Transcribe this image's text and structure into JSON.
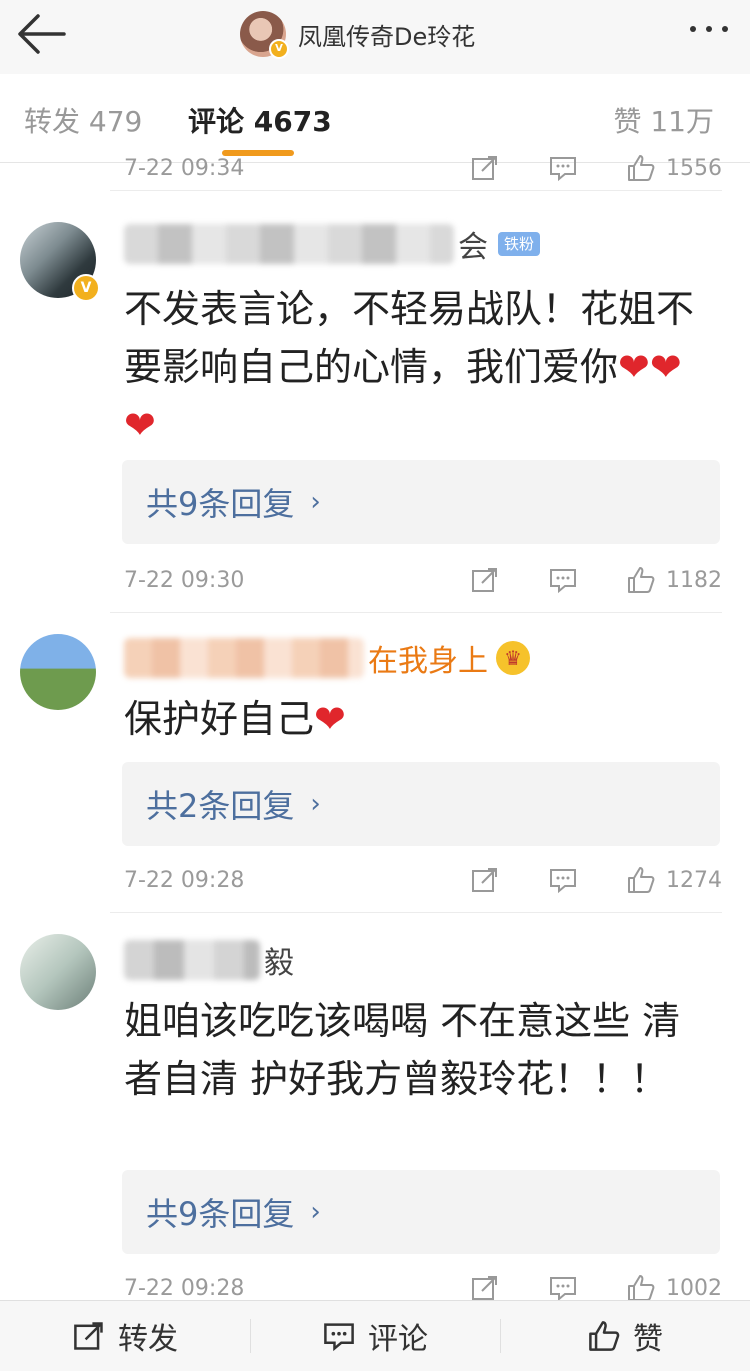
{
  "header": {
    "title": "凤凰传奇De玲花"
  },
  "tabs": {
    "repost": "转发 479",
    "comments": "评论 4673",
    "likes": "赞 11万"
  },
  "prev_comment": {
    "time": "7-22 09:34",
    "likes": "1556"
  },
  "comments": [
    {
      "name_tail": "会",
      "badge": "铁粉",
      "text": "不发表言论，不轻易战队！花姐不要影响自己的心情，我们爱你",
      "hearts": "❤❤❤",
      "replies": "共9条回复",
      "time": "7-22 09:30",
      "likes": "1182"
    },
    {
      "name_tail": "在我身上",
      "text": "保护好自己",
      "hearts": "❤",
      "replies": "共2条回复",
      "time": "7-22 09:28",
      "likes": "1274"
    },
    {
      "name_tail": "毅",
      "text": "姐咱该吃吃该喝喝  不在意这些   清者自清   护好我方曾毅玲花！！！",
      "replies": "共9条回复",
      "time": "7-22 09:28",
      "likes": "1002"
    }
  ],
  "bottom": {
    "repost": "转发",
    "comment": "评论",
    "like": "赞"
  }
}
